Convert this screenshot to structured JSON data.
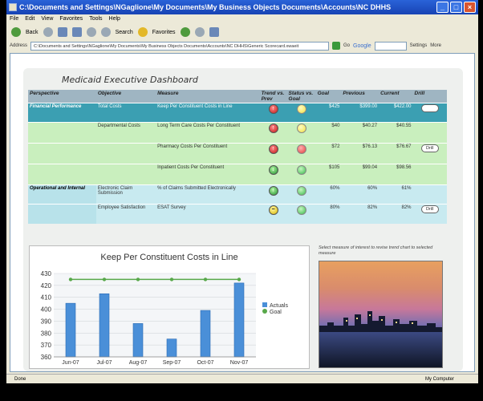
{
  "window": {
    "title": "C:\\Documents and Settings\\NGaglione\\My Documents\\My Business Objects Documents\\Accounts\\NC DHHS"
  },
  "menu": [
    "File",
    "Edit",
    "View",
    "Favorites",
    "Tools",
    "Help"
  ],
  "toolbar": {
    "back": "Back",
    "search": "Search",
    "favorites": "Favorites",
    "google": "Google",
    "settings": "Settings",
    "more": "More"
  },
  "address": {
    "label": "Address",
    "value": "C:\\Documents and Settings\\NGaglione\\My Documents\\My Business Objects Documents\\Accounts\\NC DHHS\\Generic Scorecard.xwaeit",
    "go": "Go"
  },
  "dashboard": {
    "title": "Medicaid Executive Dashboard",
    "columns": [
      "Perspective",
      "Objective",
      "Measure",
      "Trend vs. Prev",
      "Status vs. Goal",
      "Goal",
      "Previous",
      "Current",
      "Drill"
    ],
    "rows": [
      {
        "perspective": "Financial Performance",
        "objective": "Total Costs",
        "measure": "Keep Per Constituent Costs in Line",
        "trend": "red-up",
        "status": "yellow",
        "goal": "$425",
        "previous": "$399.00",
        "current": "$422.00",
        "drill": "Drill"
      },
      {
        "perspective": "",
        "objective": "Departmental Costs",
        "measure": "Long Term Care Costs Per Constituent",
        "trend": "red-up",
        "status": "yellow",
        "goal": "$40",
        "previous": "$40.27",
        "current": "$40.55",
        "drill": ""
      },
      {
        "perspective": "",
        "objective": "",
        "measure": "Pharmacy Costs Per Constituent",
        "trend": "red-up",
        "status": "red",
        "goal": "$72",
        "previous": "$76.13",
        "current": "$76.67",
        "drill": "Drill"
      },
      {
        "perspective": "",
        "objective": "",
        "measure": "Inpatient Costs Per Constituent",
        "trend": "green-down",
        "status": "green",
        "goal": "$105",
        "previous": "$99.04",
        "current": "$98.56",
        "drill": ""
      },
      {
        "perspective": "Operational and Internal",
        "objective": "Electronic Claim Submission",
        "measure": "% of Claims Submitted Electronically",
        "trend": "green-up",
        "status": "green",
        "goal": "60%",
        "previous": "60%",
        "current": "61%",
        "drill": ""
      },
      {
        "perspective": "",
        "objective": "Employee Satisfaction",
        "measure": "ESAT Survey",
        "trend": "yellow-flat",
        "status": "green",
        "goal": "80%",
        "previous": "82%",
        "current": "82%",
        "drill": "Drill"
      }
    ]
  },
  "hint": "Select measure of interest to revise trend chart to selected measure",
  "status": {
    "left": "Done",
    "right": "My Computer"
  },
  "chart_data": {
    "type": "bar",
    "title": "Keep Per Constituent Costs in Line",
    "categories": [
      "Jun-07",
      "Jul-07",
      "Aug-07",
      "Sep-07",
      "Oct-07",
      "Nov-07"
    ],
    "series": [
      {
        "name": "Actuals",
        "type": "bar",
        "values": [
          405,
          413,
          388,
          375,
          399,
          422
        ]
      },
      {
        "name": "Goal",
        "type": "line",
        "values": [
          425,
          425,
          425,
          425,
          425,
          425
        ]
      }
    ],
    "yticks": [
      360,
      370,
      380,
      390,
      400,
      410,
      420,
      430
    ],
    "ylim": [
      360,
      430
    ],
    "legend": "right",
    "colors": {
      "Actuals": "#4a8fd8",
      "Goal": "#58a84a"
    }
  }
}
